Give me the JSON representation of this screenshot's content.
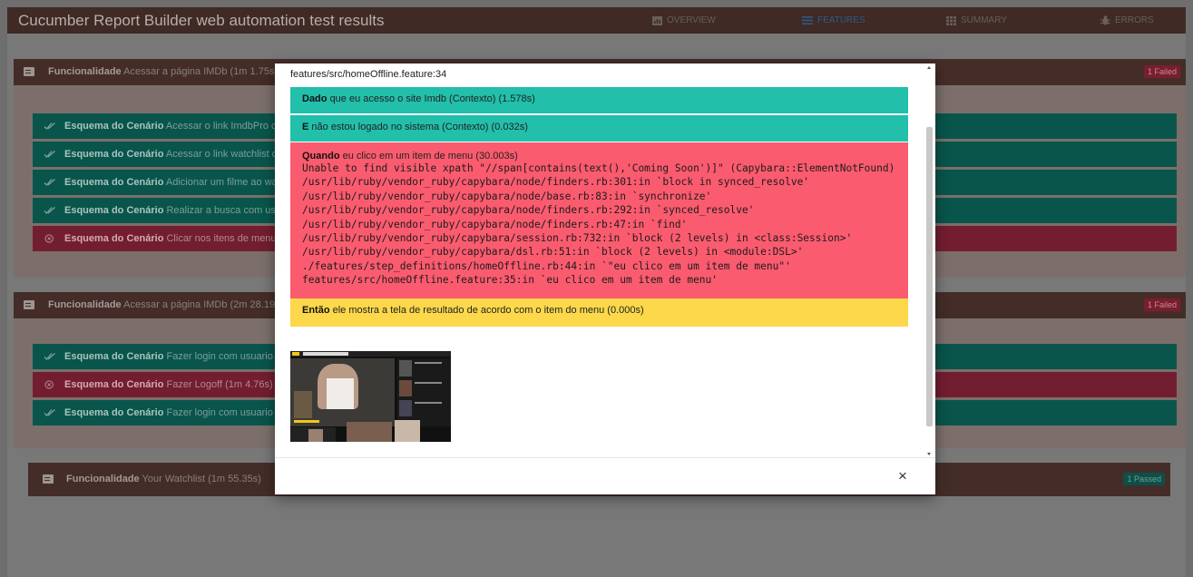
{
  "app": {
    "title": "Cucumber Report Builder web automation test results"
  },
  "nav": {
    "overview": "OVERVIEW",
    "features": "FEATURES",
    "summary": "SUMMARY",
    "errors": "ERRORS"
  },
  "features": [
    {
      "keyword": "Funcionalidade",
      "name": "Acessar a página IMDb (1m 1.75s)",
      "badge": "1 Failed",
      "scenarios": [
        {
          "status": "passed",
          "keyword": "Esquema do Cenário",
          "name": "Acessar o link ImdbPro con"
        },
        {
          "status": "passed",
          "keyword": "Esquema do Cenário",
          "name": "Acessar o link watchlist con"
        },
        {
          "status": "passed",
          "keyword": "Esquema do Cenário",
          "name": "Adicionar um filme ao watc"
        },
        {
          "status": "passed",
          "keyword": "Esquema do Cenário",
          "name": "Realizar a busca com usuar"
        },
        {
          "status": "failed",
          "keyword": "Esquema do Cenário",
          "name": "Clicar nos itens de menu co"
        }
      ]
    },
    {
      "keyword": "Funcionalidade",
      "name": "Acessar a página IMDb (2m 28.19s)",
      "badge": "1 Failed",
      "scenarios": [
        {
          "status": "passed",
          "keyword": "Esquema do Cenário",
          "name": "Fazer login com usuario Im"
        },
        {
          "status": "failed",
          "keyword": "Esquema do Cenário",
          "name": "Fazer Logoff (1m 4.76s)"
        },
        {
          "status": "passed",
          "keyword": "Esquema do Cenário",
          "name": "Fazer login com usuario Im"
        }
      ]
    },
    {
      "keyword": "Funcionalidade",
      "name": "Your Watchlist (1m 55.35s)",
      "badge": "1 Passed",
      "scenarios": []
    }
  ],
  "modal": {
    "location": "features/src/homeOffline.feature:34",
    "steps": [
      {
        "status": "passed",
        "keyword": "Dado",
        "text": "que eu acesso o site Imdb (Contexto) (1.578s)"
      },
      {
        "status": "passed",
        "keyword": "E",
        "text": "não estou logado no sistema (Contexto) (0.032s)"
      },
      {
        "status": "failed",
        "keyword": "Quando",
        "text": "eu clico em um item de menu (30.003s)",
        "error": [
          "Unable to find visible xpath \"//span[contains(text(),'Coming Soon')]\" (Capybara::ElementNotFound)",
          "/usr/lib/ruby/vendor_ruby/capybara/node/finders.rb:301:in `block in synced_resolve'",
          "/usr/lib/ruby/vendor_ruby/capybara/node/base.rb:83:in `synchronize'",
          "/usr/lib/ruby/vendor_ruby/capybara/node/finders.rb:292:in `synced_resolve'",
          "/usr/lib/ruby/vendor_ruby/capybara/node/finders.rb:47:in `find'",
          "/usr/lib/ruby/vendor_ruby/capybara/session.rb:732:in `block (2 levels) in <class:Session>'",
          "/usr/lib/ruby/vendor_ruby/capybara/dsl.rb:51:in `block (2 levels) in <module:DSL>'",
          "./features/step_definitions/homeOffline.rb:44:in `\"eu clico em um item de menu\"'",
          "features/src/homeOffline.feature:35:in `eu clico em um item de menu'"
        ]
      },
      {
        "status": "skipped",
        "keyword": "Então",
        "text": "ele mostra a tela de resultado de acordo com o item do menu (0.000s)"
      }
    ],
    "close_label": "×"
  },
  "colors": {
    "passed": "#22bfab",
    "failed": "#fb5b6f",
    "skipped": "#fcd84a",
    "appbar": "#3f2a25",
    "feature_header": "#442d28"
  }
}
